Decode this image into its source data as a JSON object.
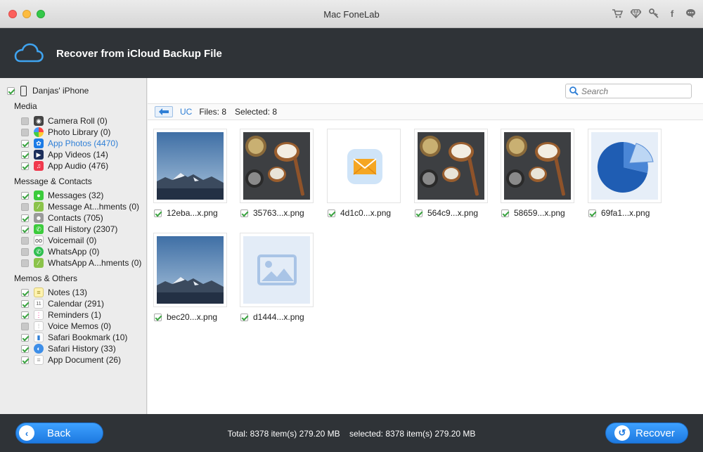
{
  "window": {
    "title": "Mac FoneLab"
  },
  "titlebar_icons": [
    "cart-icon",
    "diamond-icon",
    "key-icon",
    "facebook-icon",
    "chat-icon"
  ],
  "header": {
    "title": "Recover from iCloud Backup File"
  },
  "sidebar": {
    "device": "Danjas' iPhone",
    "groups": [
      {
        "label": "Media",
        "items": [
          {
            "label": "Camera Roll (0)",
            "checked": false,
            "icon": "camera-icon"
          },
          {
            "label": "Photo Library (0)",
            "checked": false,
            "icon": "photos-icon"
          },
          {
            "label": "App Photos (4470)",
            "checked": true,
            "icon": "app-photos-icon",
            "active": true
          },
          {
            "label": "App Videos (14)",
            "checked": true,
            "icon": "clapper-icon"
          },
          {
            "label": "App Audio (476)",
            "checked": true,
            "icon": "music-icon"
          }
        ]
      },
      {
        "label": "Message & Contacts",
        "items": [
          {
            "label": "Messages (32)",
            "checked": true,
            "icon": "messages-icon"
          },
          {
            "label": "Message At...hments (0)",
            "checked": false,
            "icon": "attachment-icon"
          },
          {
            "label": "Contacts (705)",
            "checked": true,
            "icon": "contacts-icon"
          },
          {
            "label": "Call History (2307)",
            "checked": true,
            "icon": "phone-icon"
          },
          {
            "label": "Voicemail (0)",
            "checked": false,
            "icon": "voicemail-icon"
          },
          {
            "label": "WhatsApp (0)",
            "checked": false,
            "icon": "whatsapp-icon"
          },
          {
            "label": "WhatsApp A...hments (0)",
            "checked": false,
            "icon": "attachment-icon"
          }
        ]
      },
      {
        "label": "Memos & Others",
        "items": [
          {
            "label": "Notes (13)",
            "checked": true,
            "icon": "notes-icon"
          },
          {
            "label": "Calendar (291)",
            "checked": true,
            "icon": "calendar-icon"
          },
          {
            "label": "Reminders (1)",
            "checked": true,
            "icon": "reminders-icon"
          },
          {
            "label": "Voice Memos (0)",
            "checked": false,
            "icon": "voice-memo-icon"
          },
          {
            "label": "Safari Bookmark (10)",
            "checked": true,
            "icon": "bookmark-icon"
          },
          {
            "label": "Safari History (33)",
            "checked": true,
            "icon": "safari-icon"
          },
          {
            "label": "App Document (26)",
            "checked": true,
            "icon": "document-icon"
          }
        ]
      }
    ]
  },
  "search": {
    "placeholder": "Search"
  },
  "pathbar": {
    "path": "UC",
    "files": "Files: 8",
    "selected": "Selected: 8"
  },
  "files": [
    {
      "name": "12eba...x.png",
      "checked": true,
      "kind": "mountain"
    },
    {
      "name": "35763...x.png",
      "checked": true,
      "kind": "spoons"
    },
    {
      "name": "4d1c0...x.png",
      "checked": true,
      "kind": "mail"
    },
    {
      "name": "564c9...x.png",
      "checked": true,
      "kind": "spoons"
    },
    {
      "name": "58659...x.png",
      "checked": true,
      "kind": "spoons"
    },
    {
      "name": "69fa1...x.png",
      "checked": true,
      "kind": "pie"
    },
    {
      "name": "bec20...x.png",
      "checked": true,
      "kind": "mountain"
    },
    {
      "name": "d1444...x.png",
      "checked": true,
      "kind": "placeholder"
    }
  ],
  "footer": {
    "back_label": "Back",
    "recover_label": "Recover",
    "total": "Total: 8378 item(s) 279.20 MB",
    "selected": "selected: 8378 item(s) 279.20 MB"
  },
  "colors": {
    "accent": "#2f7fd6",
    "header_bg": "#2f3337",
    "button": "#1d79e0",
    "check": "#3aa340"
  }
}
